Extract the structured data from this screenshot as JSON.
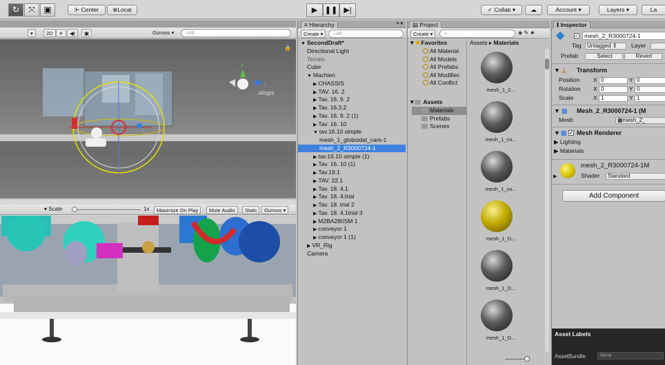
{
  "toolbar": {
    "tools": [
      "↻",
      "⤧",
      "▣"
    ],
    "center_label": "Center",
    "local_label": "Local",
    "collab_label": "Collab",
    "account_label": "Account",
    "layers_label": "Layers",
    "layout_label": "La"
  },
  "scene": {
    "buttons": [
      "2D",
      "☀",
      "◀)",
      "▣"
    ],
    "gizmos_label": "Gizmos",
    "search_placeholder": "All",
    "view_label": "≡Right",
    "axis_y": "y",
    "axis_z": "z"
  },
  "game": {
    "scale_label": "Scale",
    "scale_value": "1x",
    "scale_fraction": 0.0,
    "maximize_label": "Maximize On Play",
    "mute_label": "Mute Audio",
    "stats_label": "Stats",
    "gizmos_label": "Gizmos"
  },
  "hierarchy": {
    "tab_label": "Hierarchy",
    "create_label": "Create",
    "search_placeholder": "All",
    "items": [
      {
        "label": "SecondDraft*",
        "indent": 0,
        "arrow": "▼",
        "bold": true,
        "selected": false,
        "dim": false
      },
      {
        "label": "Directional Light",
        "indent": 1,
        "arrow": "",
        "bold": false,
        "selected": false,
        "dim": false
      },
      {
        "label": "Terrain",
        "indent": 1,
        "arrow": "",
        "bold": false,
        "selected": false,
        "dim": true
      },
      {
        "label": "Cube",
        "indent": 1,
        "arrow": "",
        "bold": false,
        "selected": false,
        "dim": false
      },
      {
        "label": "Machien",
        "indent": 1,
        "arrow": "▼",
        "bold": false,
        "selected": false,
        "dim": false
      },
      {
        "label": "CHASSIS",
        "indent": 2,
        "arrow": "▶",
        "bold": false,
        "selected": false,
        "dim": false
      },
      {
        "label": "TAV. 16. 2",
        "indent": 2,
        "arrow": "▶",
        "bold": false,
        "selected": false,
        "dim": false
      },
      {
        "label": "Tav. 16. 9. 2",
        "indent": 2,
        "arrow": "▶",
        "bold": false,
        "selected": false,
        "dim": false
      },
      {
        "label": "Tav. 16.3.2",
        "indent": 2,
        "arrow": "▶",
        "bold": false,
        "selected": false,
        "dim": false
      },
      {
        "label": "Tav. 16. 9. 2 (1)",
        "indent": 2,
        "arrow": "▶",
        "bold": false,
        "selected": false,
        "dim": false
      },
      {
        "label": "Tav. 16. 10",
        "indent": 2,
        "arrow": "▶",
        "bold": false,
        "selected": false,
        "dim": false
      },
      {
        "label": "tav.16.10 simple",
        "indent": 2,
        "arrow": "▼",
        "bold": false,
        "selected": false,
        "dim": false
      },
      {
        "label": "mesh_1_globoidal_cam-1",
        "indent": 3,
        "arrow": "",
        "bold": false,
        "selected": false,
        "dim": false
      },
      {
        "label": "mesh_2_R3000724-1",
        "indent": 3,
        "arrow": "",
        "bold": false,
        "selected": true,
        "dim": false
      },
      {
        "label": "tav.16.10 simple (1)",
        "indent": 2,
        "arrow": "▶",
        "bold": false,
        "selected": false,
        "dim": false
      },
      {
        "label": "Tav. 16. 10 (1)",
        "indent": 2,
        "arrow": "▶",
        "bold": false,
        "selected": false,
        "dim": false
      },
      {
        "label": "Tav.19.1",
        "indent": 2,
        "arrow": "▶",
        "bold": false,
        "selected": false,
        "dim": false
      },
      {
        "label": "TAV. 22.1",
        "indent": 2,
        "arrow": "▶",
        "bold": false,
        "selected": false,
        "dim": false
      },
      {
        "label": "Tav. 18. 4.1",
        "indent": 2,
        "arrow": "▶",
        "bold": false,
        "selected": false,
        "dim": false
      },
      {
        "label": "Tav. 18. 4.trial",
        "indent": 2,
        "arrow": "▶",
        "bold": false,
        "selected": false,
        "dim": false
      },
      {
        "label": "Tav. 18. trial 2",
        "indent": 2,
        "arrow": "▶",
        "bold": false,
        "selected": false,
        "dim": false
      },
      {
        "label": "Tav. 18. 4.1trial 3",
        "indent": 2,
        "arrow": "▶",
        "bold": false,
        "selected": false,
        "dim": false
      },
      {
        "label": "M2BA280SM 1",
        "indent": 2,
        "arrow": "▶",
        "bold": false,
        "selected": false,
        "dim": false
      },
      {
        "label": "conveyor 1",
        "indent": 2,
        "arrow": "▶",
        "bold": false,
        "selected": false,
        "dim": false
      },
      {
        "label": "conveyor 1 (1)",
        "indent": 2,
        "arrow": "▶",
        "bold": false,
        "selected": false,
        "dim": false
      },
      {
        "label": "VR_Rig",
        "indent": 1,
        "arrow": "▶",
        "bold": false,
        "selected": false,
        "dim": false
      },
      {
        "label": "Camera",
        "indent": 1,
        "arrow": "",
        "bold": false,
        "selected": false,
        "dim": false
      }
    ]
  },
  "project": {
    "tab_label": "Project",
    "create_label": "Create",
    "breadcrumb": [
      "Assets",
      "Materials"
    ],
    "favorites_label": "Favorites",
    "favorites": [
      "All Material",
      "All Models",
      "All Prefabs",
      "All Modifiec",
      "All Conflict"
    ],
    "assets_label": "Assets",
    "folders": [
      {
        "label": "Materials",
        "selected": true
      },
      {
        "label": "Prefabs",
        "selected": false
      },
      {
        "label": "Scenes",
        "selected": false
      }
    ],
    "materials": [
      {
        "name": "mesh_1_2...",
        "color": "gray"
      },
      {
        "name": "mesh_1_co...",
        "color": "gray"
      },
      {
        "name": "mesh_1_co...",
        "color": "gray"
      },
      {
        "name": "mesh_1_D...",
        "color": "yellow"
      },
      {
        "name": "mesh_1_D...",
        "color": "gray"
      },
      {
        "name": "mesh_1_D...",
        "color": "gray"
      }
    ]
  },
  "inspector": {
    "tab_label": "Inspector",
    "object_name": "mesh_2_R3000724-1",
    "tag_label": "Tag",
    "tag_value": "Untagged",
    "layer_label": "Layer",
    "prefab_label": "Prefab",
    "select_label": "Select",
    "revert_label": "Revert",
    "transform_label": "Transform",
    "transform_rows": [
      {
        "label": "Position",
        "x": "0",
        "y": "0"
      },
      {
        "label": "Rotation",
        "x": "0",
        "y": "0"
      },
      {
        "label": "Scale",
        "x": "1",
        "y": "1"
      }
    ],
    "filter_label": "Mesh_2_R3000724-1 (M",
    "mesh_label": "Mesh",
    "mesh_value": "mesh_2_",
    "renderer_label": "Mesh Renderer",
    "lighting_label": "Lighting",
    "materials_label": "Materials",
    "material_name": "mesh_2_R3000724-1M",
    "shader_label": "Shader",
    "shader_value": "Standard",
    "add_component_label": "Add Component",
    "asset_labels_title": "Asset Labels",
    "assetbundle_label": "AssetBundle",
    "assetbundle_value": "None"
  },
  "colors": {
    "selection": "#3d80df",
    "panel": "#c2c2c2",
    "material_yellow": "#b8a000"
  }
}
